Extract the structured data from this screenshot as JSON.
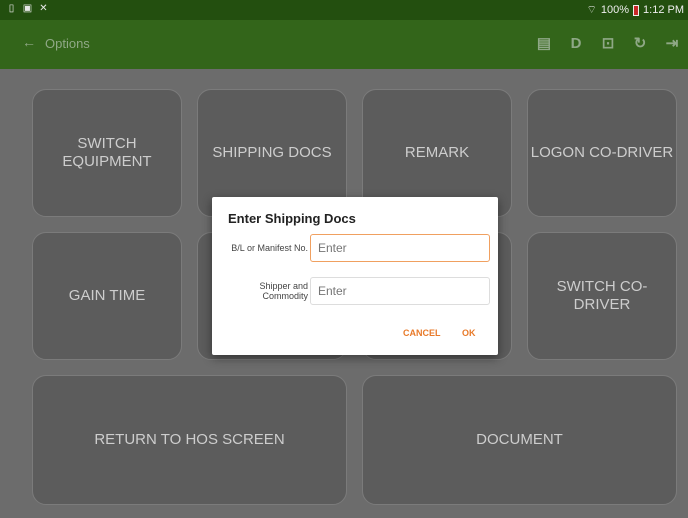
{
  "statusbar": {
    "icons": [
      "notification-icon",
      "image-icon",
      "tools-icon"
    ],
    "battery_text": "100%",
    "time": "1:12 PM"
  },
  "appbar": {
    "back_glyph": "←",
    "title": "Options",
    "actions": [
      "message-icon",
      "d-icon",
      "driver-icon",
      "refresh-icon",
      "logout-icon"
    ]
  },
  "tiles": {
    "switch_equipment": "SWITCH EQUIPMENT",
    "shipping_docs": "SHIPPING DOCS",
    "remark": "REMARK",
    "logon_co_driver": "LOGON CO-DRIVER",
    "gain_time": "GAIN TIME",
    "switch_co_driver": "SWITCH CO-DRIVER",
    "return_hos": "RETURN TO HOS SCREEN",
    "document": "DOCUMENT"
  },
  "dialog": {
    "title": "Enter Shipping Docs",
    "field1_label": "B/L or Manifest No.",
    "field1_placeholder": "Enter",
    "field2_label": "Shipper and Commodity",
    "field2_placeholder": "Enter",
    "cancel": "CANCEL",
    "ok": "OK"
  },
  "colors": {
    "statusbar": "#234f0f",
    "appbar": "#33651a",
    "accent": "#e87a2a"
  }
}
